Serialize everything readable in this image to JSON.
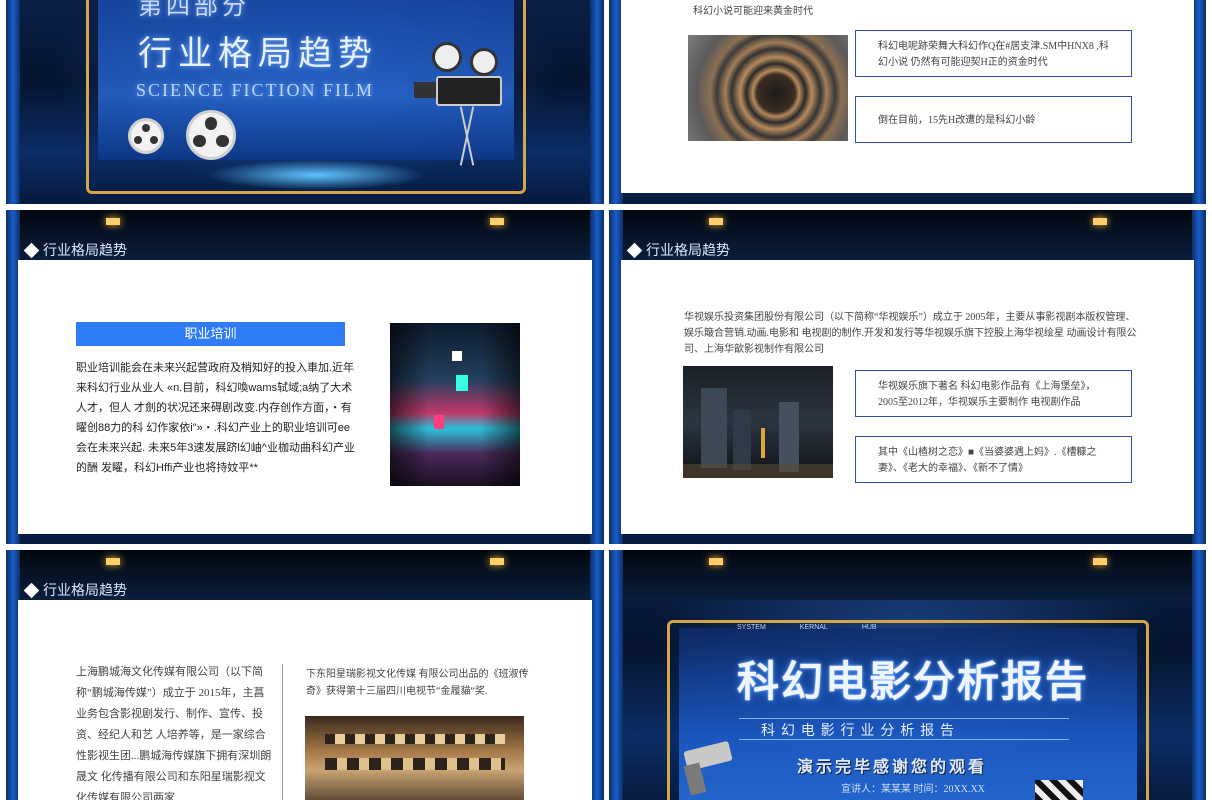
{
  "slide1": {
    "part_label": "第四部分",
    "title": "行业格局趋势",
    "subtitle_en": "SCIENCE FICTION FILM"
  },
  "slide2": {
    "top_text": "科幻小说可能迎来黄金时代",
    "box1": "科幻电呢跡荣舞大科幻作Q在#居支津.SM中HNX8 ,科幻小说 仍然有可能迎契H正的资金时代",
    "box2": "倒在目前，15先H改遭的是科幻小龄"
  },
  "slide3": {
    "section": "行业格局趋势",
    "header": "职业培训",
    "body": "职业培训能会在未来兴起营政府及梢知好的投入車加.近年来科幻行业从业人  «n.目前，科幻喚wams轼域;a纳了大术人才，但人 才劍的状况还来碍剧改变.内存创作方面，・有曜创88力的科  幻作家依i\"»・.科幻产业上的职业培训可ee会在未来兴起. 未来5年3速发展跻l幻岫^业枷动曲科幻产业的酬 发矅，科幻Hffi产业也将持妏平**"
  },
  "slide4": {
    "section": "行业格局趋势",
    "intro": "华视娱乐投资集团股份有限公司（以下简称“华视娱乐”）成立于 2005年，主要从事影视剧本版权管理、娱乐簸合营销.动画.电影和 电视剧的制作.开发和发行等华视娱乐旗下控股上海华视绘星 动画设计有限公司、上海华歆影视制作有限公司",
    "box1": "华视娱乐旗下著名 科幻电影作品有《上海堡垒》，2005至2012年，华视娱乐主要制作 电视剧作品",
    "box2": "其中《山楂树之恋》■《当婆婆遇上妈》.《槽糠之妻》、《老大的幸福》、《新不了情》"
  },
  "slide5": {
    "section": "行业格局趋势",
    "left_text": "上海鹏城海文化传媒有限公司（以下简称“鹏城海传媒”）成立于 2015年，主菖业务包含影视剧发行、制作、宣传、投资、经纪人和艺 人培养等，是一家综合性影视生团...鹏城海传媒旗下拥有深圳朗晟文 化传播有限公司和东阳星瑞影视文化传媒有限公司两家",
    "right_text": "下东阳星瑞影视文化传媒 有限公司出品的《班淑传奇》获得第十三届四川电视节“金履貓“奖."
  },
  "slide6": {
    "hud_labels": [
      "SYSTEM",
      "KERNAL",
      "HUB"
    ],
    "title": "科幻电影分析报告",
    "subtitle": "科 幻 电 影 行 业 分 析 报 告",
    "thanks": "演示完毕感谢您的观看",
    "presenter": "宣讲人：某某某   时间：20XX.XX"
  },
  "colors": {
    "accent_blue": "#2f7cf6",
    "box_border": "#2d4fb3",
    "frame_gold": "#d5a54a",
    "scifi_navy": "#061a3d"
  }
}
